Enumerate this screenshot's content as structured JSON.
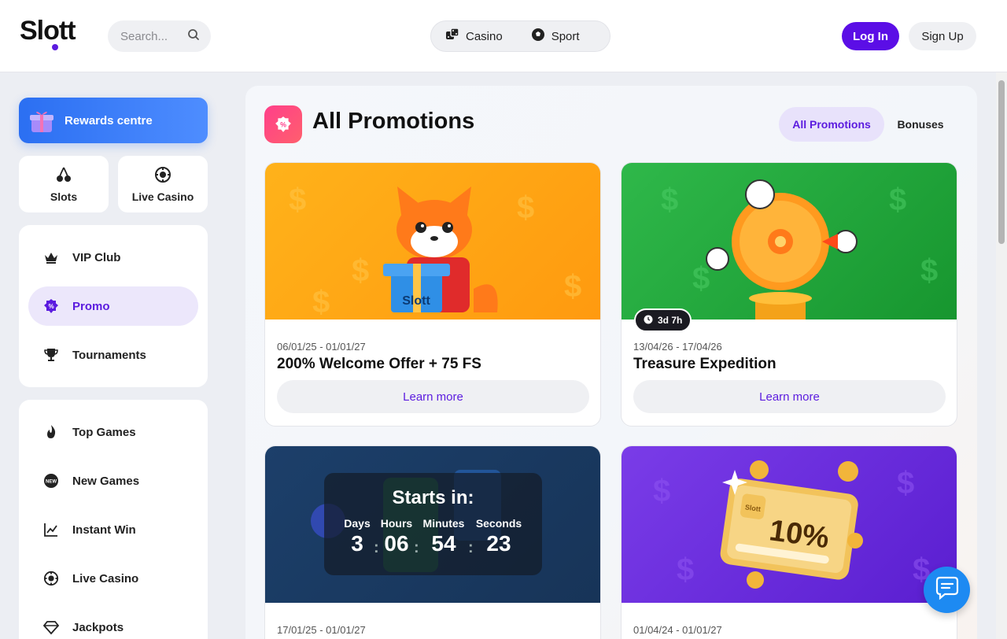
{
  "header": {
    "logo": "Slott",
    "search_placeholder": "Search...",
    "toggle": [
      {
        "label": "Casino",
        "icon": "dice-icon"
      },
      {
        "label": "Sport",
        "icon": "soccer-ball-icon"
      }
    ],
    "login_label": "Log In",
    "signup_label": "Sign Up"
  },
  "sidebar": {
    "rewards_label": "Rewards centre",
    "tiles": [
      {
        "label": "Slots",
        "icon": "cherries-icon"
      },
      {
        "label": "Live Casino",
        "icon": "chip-icon"
      }
    ],
    "nav_primary": [
      {
        "label": "VIP Club",
        "icon": "crown-icon"
      },
      {
        "label": "Promo",
        "icon": "percent-icon"
      },
      {
        "label": "Tournaments",
        "icon": "trophy-icon"
      }
    ],
    "nav_games": [
      {
        "label": "Top Games",
        "icon": "flame-icon"
      },
      {
        "label": "New Games",
        "icon": "new-badge-icon"
      },
      {
        "label": "Instant Win",
        "icon": "chart-up-icon"
      },
      {
        "label": "Live Casino",
        "icon": "chip-icon"
      },
      {
        "label": "Jackpots",
        "icon": "diamond-icon"
      }
    ]
  },
  "main": {
    "title": "All Promotions",
    "filters": {
      "all": "All Promotions",
      "bonuses": "Bonuses"
    },
    "cards": [
      {
        "date": "06/01/25 - 01/01/27",
        "title": "200% Welcome Offer + 75 FS",
        "button": "Learn more",
        "box_text": "Slott"
      },
      {
        "date": "13/04/26 - 17/04/26",
        "title": "Treasure Expedition",
        "button": "Learn more",
        "timer": "3d 7h"
      },
      {
        "date": "17/01/25 - 01/01/27",
        "countdown": {
          "title": "Starts in:",
          "labels": [
            "Days",
            "Hours",
            "Minutes",
            "Seconds"
          ],
          "values": [
            "3",
            "06",
            "54",
            "23"
          ]
        }
      },
      {
        "date": "01/04/24 - 01/01/27",
        "card_text": "10%",
        "card_brand": "Slott"
      }
    ]
  },
  "colors": {
    "brand": "#5b0ee6",
    "accent_blue": "#2b6ff2",
    "chat": "#1d8af2"
  }
}
